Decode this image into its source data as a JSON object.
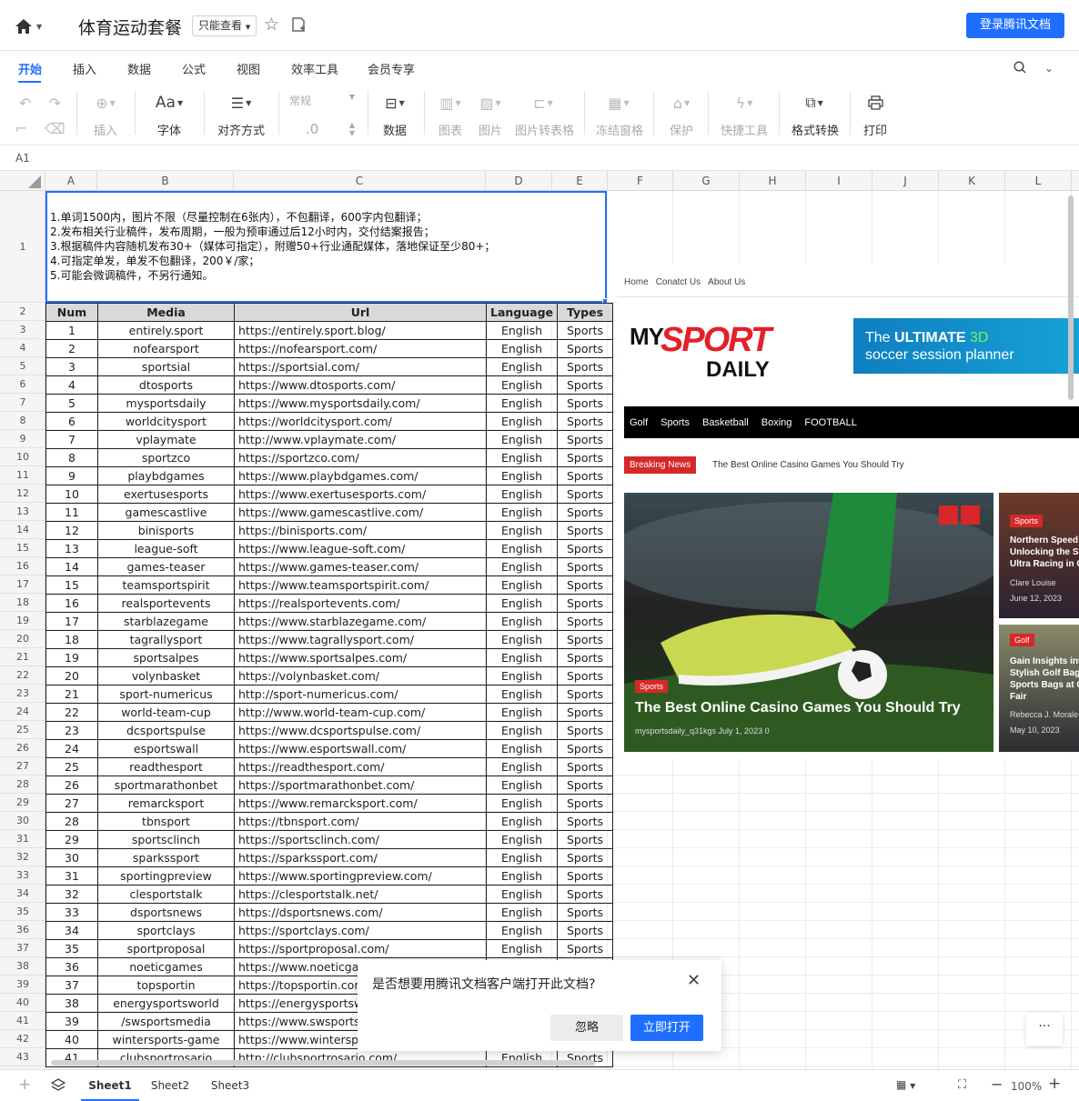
{
  "header": {
    "title": "体育运动套餐",
    "readonly_label": "只能查看",
    "login_label": "登录腾讯文档"
  },
  "menu": {
    "tabs": [
      "开始",
      "插入",
      "数据",
      "公式",
      "视图",
      "效率工具",
      "会员专享"
    ],
    "active": "开始"
  },
  "toolbar": {
    "insert": "插入",
    "font": "字体",
    "align": "对齐方式",
    "format_value": "常规",
    "decimal": ".0",
    "data": "数据",
    "chart": "图表",
    "image": "图片",
    "img_to_table": "图片转表格",
    "freeze": "冻结窗格",
    "protect": "保护",
    "quick_tools": "快捷工具",
    "format_convert": "格式转换",
    "print": "打印"
  },
  "namebox": {
    "cell": "A1"
  },
  "columns": [
    "A",
    "B",
    "C",
    "D",
    "E",
    "F",
    "G",
    "H",
    "I",
    "J",
    "K",
    "L"
  ],
  "notes": [
    "1.单词1500内，图片不限（尽量控制在6张内），不包翻译，600字内包翻译；",
    "2.发布相关行业稿件，发布周期，一般为预审通过后12小时内，交付结案报告；",
    "3.根据稿件内容随机发布30+（媒体可指定），附赠50+行业通配媒体，落地保证至少80+；",
    "4.可指定单发，单发不包翻译，200￥/家；",
    "5.可能会微调稿件，不另行通知。"
  ],
  "table": {
    "headers": [
      "Num",
      "Media",
      "Url",
      "Language",
      "Types"
    ],
    "rows": [
      [
        "1",
        "entirely.sport",
        "https://entirely.sport.blog/",
        "English",
        "Sports"
      ],
      [
        "2",
        "nofearsport",
        "https://nofearsport.com/",
        "English",
        "Sports"
      ],
      [
        "3",
        "sportsial",
        "https://sportsial.com/",
        "English",
        "Sports"
      ],
      [
        "4",
        "dtosports",
        "https://www.dtosports.com/",
        "English",
        "Sports"
      ],
      [
        "5",
        "mysportsdaily",
        "https://www.mysportsdaily.com/",
        "English",
        "Sports"
      ],
      [
        "6",
        "worldcitysport",
        "https://worldcitysport.com/",
        "English",
        "Sports"
      ],
      [
        "7",
        "vplaymate",
        "http://www.vplaymate.com/",
        "English",
        "Sports"
      ],
      [
        "8",
        "sportzco",
        "https://sportzco.com/",
        "English",
        "Sports"
      ],
      [
        "9",
        "playbdgames",
        "https://www.playbdgames.com/",
        "English",
        "Sports"
      ],
      [
        "10",
        "exertusesports",
        "https://www.exertusesports.com/",
        "English",
        "Sports"
      ],
      [
        "11",
        "gamescastlive",
        "https://www.gamescastlive.com/",
        "English",
        "Sports"
      ],
      [
        "12",
        "binisports",
        "https://binisports.com/",
        "English",
        "Sports"
      ],
      [
        "13",
        "league-soft",
        "https://www.league-soft.com/",
        "English",
        "Sports"
      ],
      [
        "14",
        "games-teaser",
        "https://www.games-teaser.com/",
        "English",
        "Sports"
      ],
      [
        "15",
        "teamsportspirit",
        "https://www.teamsportspirit.com/",
        "English",
        "Sports"
      ],
      [
        "16",
        "realsportevents",
        "https://realsportevents.com/",
        "English",
        "Sports"
      ],
      [
        "17",
        "starblazegame",
        "https://www.starblazegame.com/",
        "English",
        "Sports"
      ],
      [
        "18",
        "tagrallysport",
        "https://www.tagrallysport.com/",
        "English",
        "Sports"
      ],
      [
        "19",
        "sportsalpes",
        "https://www.sportsalpes.com/",
        "English",
        "Sports"
      ],
      [
        "20",
        "volynbasket",
        "https://volynbasket.com/",
        "English",
        "Sports"
      ],
      [
        "21",
        "sport-numericus",
        "http://sport-numericus.com/",
        "English",
        "Sports"
      ],
      [
        "22",
        "world-team-cup",
        "http://www.world-team-cup.com/",
        "English",
        "Sports"
      ],
      [
        "23",
        "dcsportspulse",
        "https://www.dcsportspulse.com/",
        "English",
        "Sports"
      ],
      [
        "24",
        "esportswall",
        "https://www.esportswall.com/",
        "English",
        "Sports"
      ],
      [
        "25",
        "readthesport",
        "https://readthesport.com/",
        "English",
        "Sports"
      ],
      [
        "26",
        "sportmarathonbet",
        "https://sportmarathonbet.com/",
        "English",
        "Sports"
      ],
      [
        "27",
        "remarcksport",
        "https://www.remarcksport.com/",
        "English",
        "Sports"
      ],
      [
        "28",
        "tbnsport",
        "https://tbnsport.com/",
        "English",
        "Sports"
      ],
      [
        "29",
        "sportsclinch",
        "https://sportsclinch.com/",
        "English",
        "Sports"
      ],
      [
        "30",
        "sparkssport",
        "https://sparkssport.com/",
        "English",
        "Sports"
      ],
      [
        "31",
        "sportingpreview",
        "https://www.sportingpreview.com/",
        "English",
        "Sports"
      ],
      [
        "32",
        "clesportstalk",
        "https://clesportstalk.net/",
        "English",
        "Sports"
      ],
      [
        "33",
        "dsportsnews",
        "https://dsportsnews.com/",
        "English",
        "Sports"
      ],
      [
        "34",
        "sportclays",
        "https://sportclays.com/",
        "English",
        "Sports"
      ],
      [
        "35",
        "sportproposal",
        "https://sportproposal.com/",
        "English",
        "Sports"
      ],
      [
        "36",
        "noeticgames",
        "https://www.noeticgam",
        "",
        ""
      ],
      [
        "37",
        "topsportin",
        "https://topsportin.com/",
        "",
        ""
      ],
      [
        "38",
        "energysportsworld",
        "https://energysportswo",
        "",
        ""
      ],
      [
        "39",
        "/swsportsmedia",
        "https://www.swsportsm",
        "",
        ""
      ],
      [
        "40",
        "wintersports-game",
        "https://www.wintersport",
        "",
        ""
      ],
      [
        "41",
        "clubsportrosario",
        "http://clubsportrosario.com/",
        "English",
        "Sports"
      ]
    ]
  },
  "site": {
    "nav": [
      "Home",
      "Conatct Us",
      "About Us"
    ],
    "logo_top": "MY",
    "logo_sport": "SPORT",
    "logo_daily": "DAILY",
    "banner_line1a": "The ",
    "banner_line1b": "ULTIMATE ",
    "banner_line1c": "3D",
    "banner_line2": "soccer session planner",
    "menu": [
      "Golf",
      "Sports",
      "Basketball",
      "Boxing",
      "FOOTBALL"
    ],
    "breaking_label": "Breaking News",
    "breaking_text": "The Best Online Casino Games You Should Try",
    "hero_tag": "Sports",
    "hero_title": "The Best Online Casino Games You Should Try",
    "hero_meta": "mysportsdaily_q31kgs   July 1, 2023   0",
    "side1_tag": "Sports",
    "side1_title": [
      "Northern Speed:",
      "Unlocking the Se",
      "Ultra Racing in Ca"
    ],
    "side1_author": "Clare Louise",
    "side1_date": "June 12, 2023",
    "side2_tag": "Golf",
    "side2_title": [
      "Gain Insights into",
      "Stylish Golf Bags",
      "Sports Bags at C",
      "Fair"
    ],
    "side2_author": "Rebecca J. Morale",
    "side2_date": "May 10, 2023"
  },
  "dialog": {
    "message": "是否想要用腾讯文档客户端打开此文档?",
    "ignore": "忽略",
    "open": "立即打开"
  },
  "more_label": "···",
  "sheets": [
    "Sheet1",
    "Sheet2",
    "Sheet3"
  ],
  "zoom": "100%",
  "icons": [
    "home-icon",
    "star-icon",
    "save-icon",
    "search-icon",
    "close-icon",
    "print-icon",
    "layers-icon"
  ]
}
